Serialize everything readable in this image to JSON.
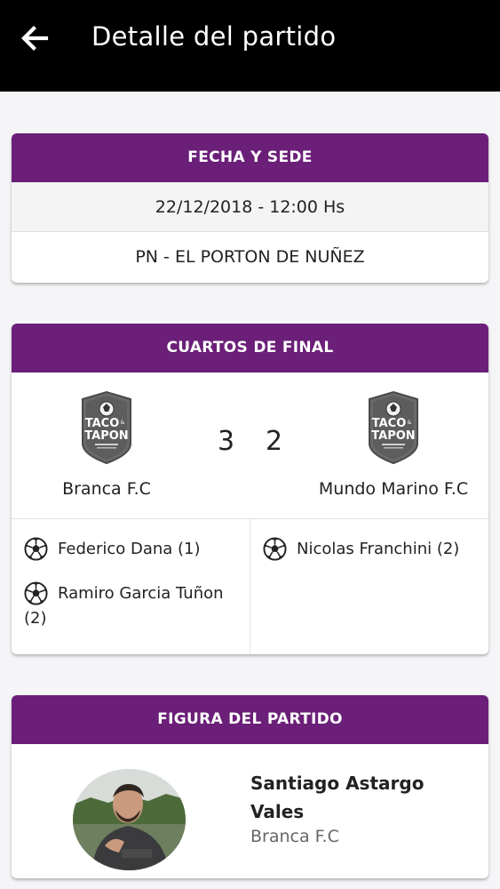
{
  "header": {
    "title": "Detalle del partido",
    "back_icon": "arrow-left-icon"
  },
  "fecha_sede": {
    "title": "FECHA Y SEDE",
    "datetime": "22/12/2018 - 12:00 Hs",
    "venue": "PN - EL PORTON DE NUÑEZ"
  },
  "match": {
    "title": "CUARTOS DE FINAL",
    "home": {
      "name": "Branca F.C",
      "score": "3",
      "logo_text": [
        "TACO",
        "TAPON"
      ]
    },
    "away": {
      "name": "Mundo Marino F.C",
      "score": "2",
      "logo_text": [
        "TACO",
        "TAPON"
      ]
    },
    "home_scorers": [
      {
        "name": "Federico Dana (1)"
      },
      {
        "name_line1": "Ramiro Garcia Tuñon",
        "name_line2": "(2)"
      }
    ],
    "away_scorers": [
      {
        "name": "Nicolas Franchini (2)"
      }
    ]
  },
  "figura": {
    "title": "FIGURA DEL PARTIDO",
    "player_name": "Santiago Astargo Vales",
    "team": "Branca F.C"
  },
  "colors": {
    "header_bg": "#000000",
    "accent": "#6b1f78",
    "background": "#f5f5f7"
  }
}
